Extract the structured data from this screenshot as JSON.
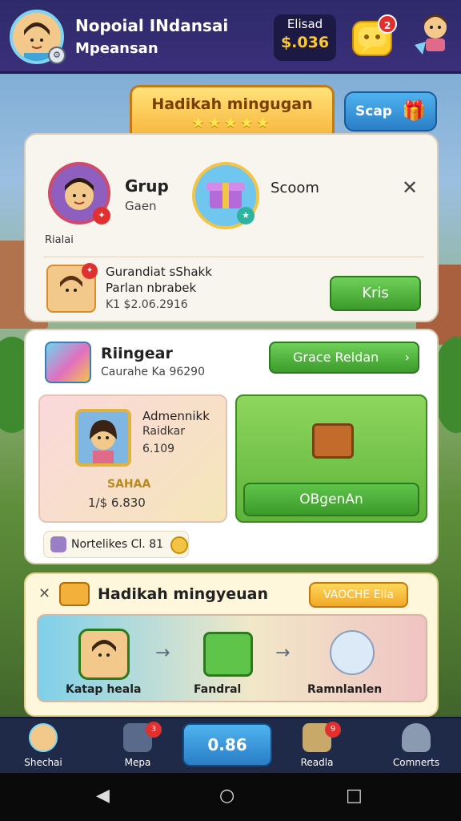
{
  "header": {
    "title": "Nopoial INdansai",
    "subtitle": "Mpeansan",
    "coin_label": "Elisad",
    "coin_value": "$.036",
    "chat_badge": "2",
    "avatar_icon": "player-avatar"
  },
  "reward_banner": {
    "title": "Hadikah mingugan",
    "stars": "★★★★★"
  },
  "stop_button": {
    "label": "Scap"
  },
  "card_group": {
    "group_title": "Grup",
    "group_subtitle": "Gaen",
    "group_note": "Rialai",
    "scoom_title": "Scoom",
    "close_symbol": "✕",
    "guard_line1": "Gurandiat sShakk",
    "guard_line2": "Parlan nbrabek",
    "guard_line3": "K1 $2.06.2916",
    "kris_button": "Kris"
  },
  "card_shop": {
    "title": "Riingear",
    "subtitle": "Caurahe Ka 96290",
    "grace_button": "Grace Reldan",
    "adm_name": "Admennikk",
    "adm_sub": "Raidkar",
    "adm_count": "6.109",
    "adm_label": "SAHAA",
    "adm_price": "1/$ 6.830",
    "obgen_button": "OBgenAn",
    "notif_text": "Nortelikes Cl. 81"
  },
  "card_weekly": {
    "title": "Hadikah mingyeuan",
    "button": "VAOCHE Ella",
    "steps": [
      {
        "label": "Katap heala"
      },
      {
        "label": "Fandral"
      },
      {
        "label": "Ramnlanlen"
      }
    ]
  },
  "bottom_nav": {
    "items": [
      {
        "label": "Shechai"
      },
      {
        "label": "Mepa",
        "badge": "3"
      },
      {
        "label": "Readla",
        "badge": "9"
      },
      {
        "label": "Comnerts"
      }
    ],
    "center_label": "0.86"
  },
  "colors": {
    "topbar": "#2d2a6a",
    "accent_green": "#3c9b2a",
    "accent_blue": "#2a7ec6",
    "accent_gold": "#f3c546"
  }
}
